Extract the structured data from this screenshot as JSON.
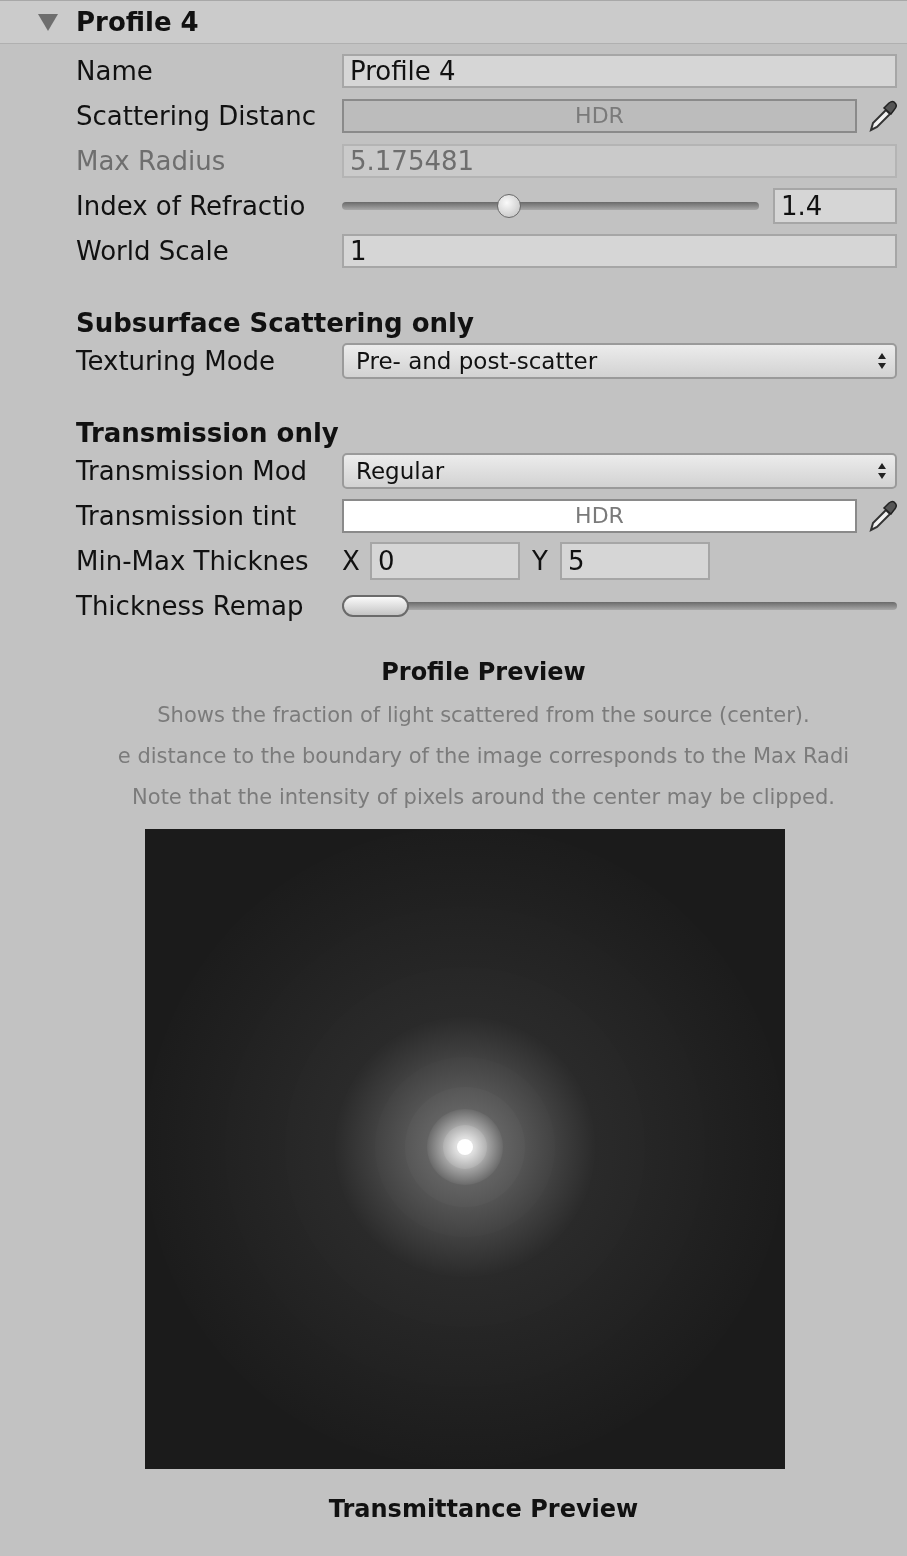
{
  "foldout": {
    "title": "Profile 4",
    "expanded": true
  },
  "sections": [
    {
      "rows": [
        {
          "kind": "text",
          "label": "Name",
          "value": "Profile 4",
          "disabled": false
        },
        {
          "kind": "color",
          "label": "Scattering Distanc",
          "value": "HDR",
          "color": "#bcbcbc"
        },
        {
          "kind": "text",
          "label": "Max Radius",
          "value": "5.175481",
          "disabled": true
        },
        {
          "kind": "slider",
          "label": "Index of Refractio",
          "level": 0.4,
          "value": "1.4"
        },
        {
          "kind": "text",
          "label": "World Scale",
          "value": "1",
          "disabled": false
        }
      ]
    },
    {
      "heading": "Subsurface Scattering only",
      "rows": [
        {
          "kind": "dropdown",
          "label": "Texturing Mode",
          "value": "Pre- and post-scatter"
        }
      ]
    },
    {
      "heading": "Transmission only",
      "rows": [
        {
          "kind": "dropdown",
          "label": "Transmission Mod",
          "value": "Regular"
        },
        {
          "kind": "color",
          "label": "Transmission tint",
          "value": "HDR",
          "color": "#ffffff"
        },
        {
          "kind": "minmax",
          "label": "Min-Max Thicknes",
          "x_label": "X",
          "x_value": "0",
          "y_label": "Y",
          "y_value": "5"
        },
        {
          "kind": "range",
          "label": "Thickness Remap",
          "level": 0.12
        }
      ]
    }
  ],
  "preview": {
    "title": "Profile Preview",
    "notes": [
      "Shows the fraction of light scattered from the source (center).",
      "e distance to the boundary of the image corresponds to the Max Radi",
      "Note that the intensity of pixels around the center may be clipped."
    ],
    "kind": "picture"
  },
  "footer_title": "Transmittance Preview"
}
